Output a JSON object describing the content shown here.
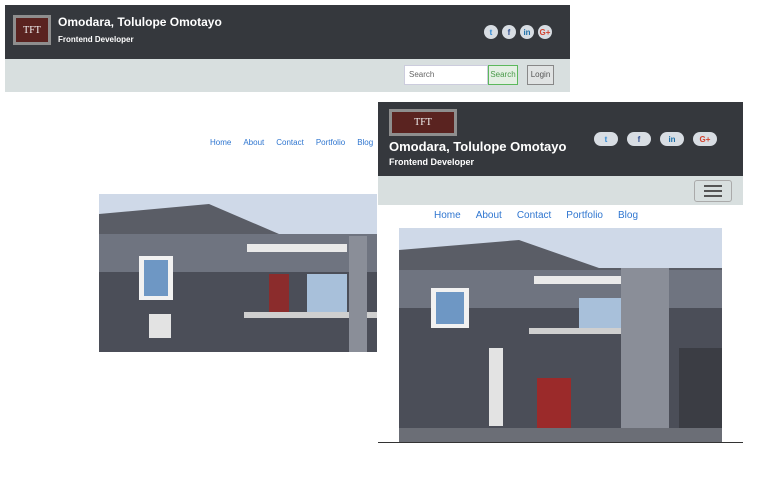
{
  "desktop": {
    "logo_text": "TFT",
    "name": "Omodara, Tolulope Omotayo",
    "role": "Frontend Developer",
    "social_icons": [
      "twitter-icon",
      "facebook-icon",
      "linkedin-icon",
      "google-plus-icon"
    ],
    "search_placeholder": "Search",
    "search_button": "Search",
    "login_button": "Login",
    "nav": [
      "Home",
      "About",
      "Contact",
      "Portfolio",
      "Blog"
    ]
  },
  "mobile": {
    "logo_text": "TFT",
    "name": "Omodara, Tolulope Omotayo",
    "role": "Frontend Developer",
    "social_icons": [
      "twitter-icon",
      "facebook-icon",
      "linkedin-icon",
      "google-plus-icon"
    ],
    "nav": [
      "Home",
      "About",
      "Contact",
      "Portfolio",
      "Blog"
    ]
  },
  "colors": {
    "header_bg": "#35383d",
    "bar_bg": "#d8dfdf",
    "link": "#2f76d0",
    "logo_bg": "#5a2320"
  }
}
